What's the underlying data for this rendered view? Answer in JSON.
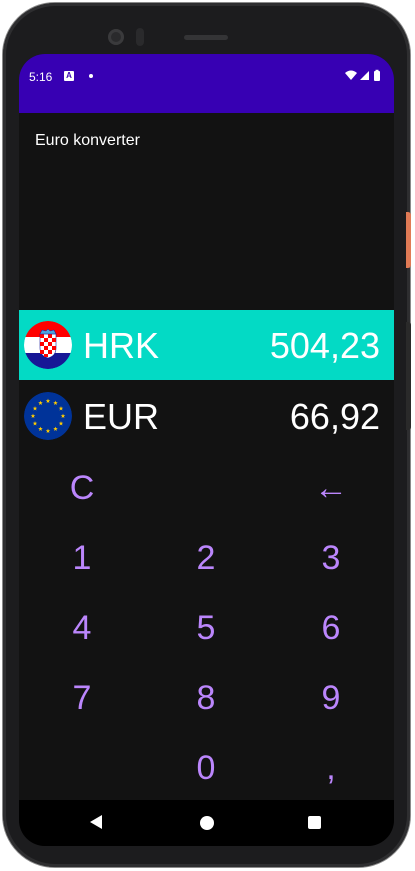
{
  "status_bar": {
    "time": "5:16",
    "notification_icon_letter": "A",
    "icons": [
      "wifi-icon",
      "signal-icon",
      "battery-icon"
    ]
  },
  "app": {
    "title": "Euro konverter",
    "statusbar_color": "#3700b3",
    "accent_color": "#03dac5",
    "key_color": "#bb86fc"
  },
  "currencies": [
    {
      "code": "HRK",
      "value": "504,23",
      "flag": "croatia-flag-icon",
      "selected": true
    },
    {
      "code": "EUR",
      "value": "66,92",
      "flag": "eu-flag-icon",
      "selected": false
    }
  ],
  "keypad": {
    "clear": "C",
    "backspace": "←",
    "k1": "1",
    "k2": "2",
    "k3": "3",
    "k4": "4",
    "k5": "5",
    "k6": "6",
    "k7": "7",
    "k8": "8",
    "k9": "9",
    "k0": "0",
    "decimal": ","
  },
  "nav_bar": {
    "icons": [
      "back-icon",
      "home-icon",
      "recents-icon"
    ]
  }
}
